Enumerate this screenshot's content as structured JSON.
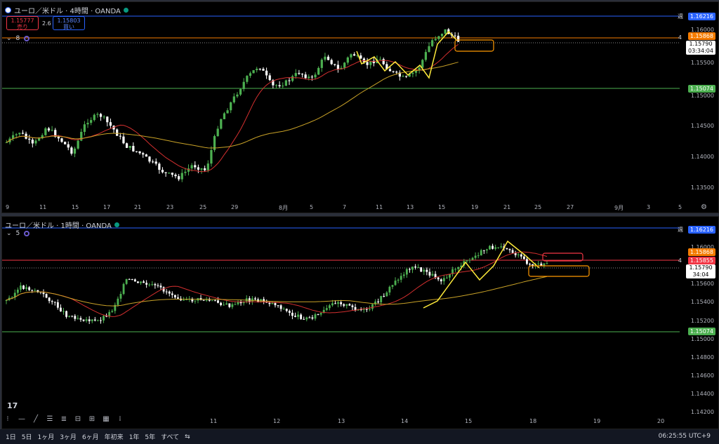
{
  "pane1": {
    "title": "ユーロ／米ドル · 4時間 · OANDA",
    "sell_price": "1.15777",
    "sell_label": "売り",
    "spread": "2.6",
    "buy_price": "1.15803",
    "buy_label": "買い",
    "indicator_count": "8",
    "price_axis": [
      "1.16000",
      "1.15500",
      "1.15000",
      "1.14500",
      "1.14000",
      "1.13500"
    ],
    "tag_weekly": "1.16216",
    "tag_weekly_label": "週",
    "tag_4": "1.15868",
    "tag_4_label": "4",
    "current_price": "1.15790",
    "countdown": "03:34:04",
    "tag_green": "1.15074",
    "x_labels": [
      "9",
      "11",
      "15",
      "17",
      "21",
      "23",
      "25",
      "29",
      "8月",
      "5",
      "7",
      "11",
      "13",
      "15",
      "19",
      "21",
      "25",
      "27",
      "9月",
      "3",
      "5"
    ]
  },
  "pane2": {
    "title": "ユーロ／米ドル · 1時間 · OANDA",
    "indicator_count": "5",
    "price_axis": [
      "1.16000",
      "1.15600",
      "1.15400",
      "1.15200",
      "1.15000",
      "1.14800",
      "1.14600",
      "1.14400",
      "1.14200"
    ],
    "tag_weekly": "1.16216",
    "tag_weekly_label": "週",
    "tag_4": "1.15868",
    "tag_4_label": "4",
    "tag_red": "1.15855",
    "current_price": "1.15790",
    "countdown": "34:04",
    "tag_green": "1.15074",
    "x_labels": [
      "11",
      "12",
      "13",
      "14",
      "15",
      "18",
      "19",
      "20"
    ]
  },
  "toolbar": {
    "timeframes": [
      "1日",
      "5日",
      "1ヶ月",
      "3ヶ月",
      "6ヶ月",
      "年初来",
      "1年",
      "5年",
      "すべて"
    ],
    "clock": "06:25:55 UTC+9"
  },
  "colors": {
    "bull": "#4caf50",
    "bear": "#ffffff",
    "ma_red": "#d32f2f",
    "ma_gold": "#c9a227",
    "ma_blue": "#2962ff",
    "weekly_line": "#2962ff",
    "line4": "#f57c00",
    "green_line": "#4caf50",
    "zigzag": "#ffeb3b",
    "box": "#ff9800"
  }
}
